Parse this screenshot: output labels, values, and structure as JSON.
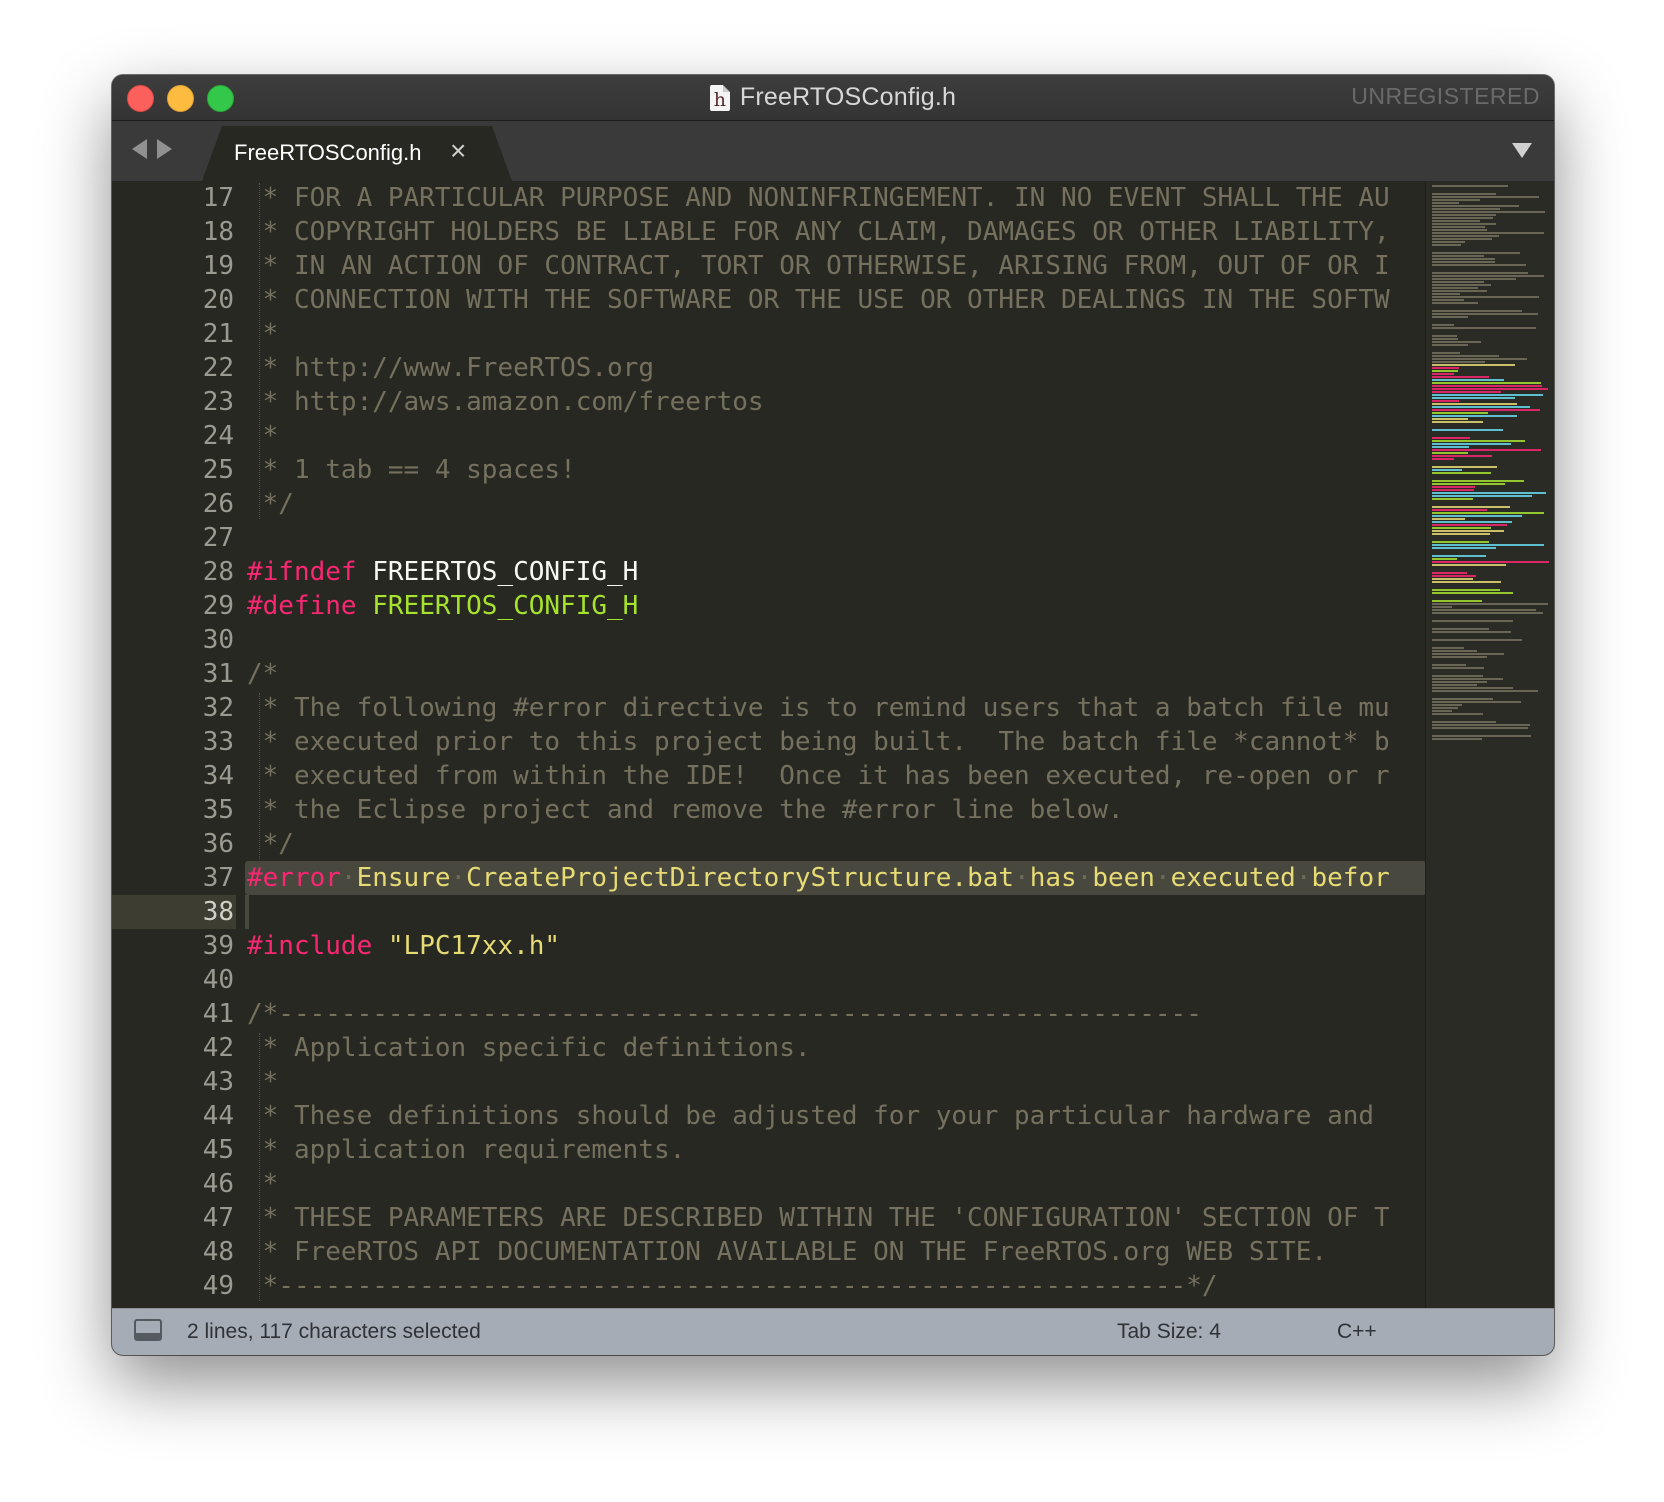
{
  "window": {
    "title": "FreeRTOSConfig.h",
    "file_icon_glyph": "h",
    "registration": "UNREGISTERED"
  },
  "tabs": [
    {
      "label": "FreeRTOSConfig.h",
      "close_glyph": "×",
      "active": true
    }
  ],
  "editor": {
    "current_line": 38,
    "selected_lines": [
      37,
      38
    ],
    "lines": [
      {
        "n": "17",
        "tokens": [
          {
            "t": " * FOR A PARTICULAR PURPOSE AND NONINFRINGEMENT. IN NO EVENT SHALL THE AU",
            "k": "comment"
          }
        ]
      },
      {
        "n": "18",
        "tokens": [
          {
            "t": " * COPYRIGHT HOLDERS BE LIABLE FOR ANY CLAIM, DAMAGES OR OTHER LIABILITY, ",
            "k": "comment"
          }
        ]
      },
      {
        "n": "19",
        "tokens": [
          {
            "t": " * IN AN ACTION OF CONTRACT, TORT OR OTHERWISE, ARISING FROM, OUT OF OR I",
            "k": "comment"
          }
        ]
      },
      {
        "n": "20",
        "tokens": [
          {
            "t": " * CONNECTION WITH THE SOFTWARE OR THE USE OR OTHER DEALINGS IN THE SOFTW",
            "k": "comment"
          }
        ]
      },
      {
        "n": "21",
        "tokens": [
          {
            "t": " *",
            "k": "comment"
          }
        ]
      },
      {
        "n": "22",
        "tokens": [
          {
            "t": " * http://www.FreeRTOS.org",
            "k": "comment"
          }
        ]
      },
      {
        "n": "23",
        "tokens": [
          {
            "t": " * http://aws.amazon.com/freertos",
            "k": "comment"
          }
        ]
      },
      {
        "n": "24",
        "tokens": [
          {
            "t": " *",
            "k": "comment"
          }
        ]
      },
      {
        "n": "25",
        "tokens": [
          {
            "t": " * 1 tab == 4 spaces!",
            "k": "comment"
          }
        ]
      },
      {
        "n": "26",
        "tokens": [
          {
            "t": " */",
            "k": "comment"
          }
        ]
      },
      {
        "n": "27",
        "tokens": []
      },
      {
        "n": "28",
        "tokens": [
          {
            "t": "#ifndef",
            "k": "kw"
          },
          {
            "t": " FREERTOS_CONFIG_H",
            "k": "id"
          }
        ]
      },
      {
        "n": "29",
        "tokens": [
          {
            "t": "#define",
            "k": "kw"
          },
          {
            "t": " FREERTOS_CONFIG_H",
            "k": "def"
          }
        ]
      },
      {
        "n": "30",
        "tokens": []
      },
      {
        "n": "31",
        "tokens": [
          {
            "t": "/*",
            "k": "comment"
          }
        ]
      },
      {
        "n": "32",
        "tokens": [
          {
            "t": " * The following #error directive is to remind users that a batch file mu",
            "k": "comment"
          }
        ]
      },
      {
        "n": "33",
        "tokens": [
          {
            "t": " * executed prior to this project being built.  The batch file *cannot* b",
            "k": "comment"
          }
        ]
      },
      {
        "n": "34",
        "tokens": [
          {
            "t": " * executed from within the IDE!  Once it has been executed, re-open or r",
            "k": "comment"
          }
        ]
      },
      {
        "n": "35",
        "tokens": [
          {
            "t": " * the Eclipse project and remove the #error line below.",
            "k": "comment"
          }
        ]
      },
      {
        "n": "36",
        "tokens": [
          {
            "t": " */",
            "k": "comment"
          }
        ]
      },
      {
        "n": "37",
        "tokens": [
          {
            "t": "#error",
            "k": "kw"
          },
          {
            "t": "·",
            "k": "ws"
          },
          {
            "t": "Ensure",
            "k": "str"
          },
          {
            "t": "·",
            "k": "ws"
          },
          {
            "t": "CreateProjectDirectoryStructure.bat",
            "k": "str"
          },
          {
            "t": "·",
            "k": "ws"
          },
          {
            "t": "has",
            "k": "str"
          },
          {
            "t": "·",
            "k": "ws"
          },
          {
            "t": "been",
            "k": "str"
          },
          {
            "t": "·",
            "k": "ws"
          },
          {
            "t": "executed",
            "k": "str"
          },
          {
            "t": "·",
            "k": "ws"
          },
          {
            "t": "befor",
            "k": "str"
          }
        ]
      },
      {
        "n": "38",
        "tokens": []
      },
      {
        "n": "39",
        "tokens": [
          {
            "t": "#include",
            "k": "kw"
          },
          {
            "t": " \"LPC17xx.h\"",
            "k": "str"
          }
        ]
      },
      {
        "n": "40",
        "tokens": []
      },
      {
        "n": "41",
        "tokens": [
          {
            "t": "/*-----------------------------------------------------------",
            "k": "comment"
          }
        ]
      },
      {
        "n": "42",
        "tokens": [
          {
            "t": " * Application specific definitions.",
            "k": "comment"
          }
        ]
      },
      {
        "n": "43",
        "tokens": [
          {
            "t": " *",
            "k": "comment"
          }
        ]
      },
      {
        "n": "44",
        "tokens": [
          {
            "t": " * These definitions should be adjusted for your particular hardware and",
            "k": "comment"
          }
        ]
      },
      {
        "n": "45",
        "tokens": [
          {
            "t": " * application requirements.",
            "k": "comment"
          }
        ]
      },
      {
        "n": "46",
        "tokens": [
          {
            "t": " *",
            "k": "comment"
          }
        ]
      },
      {
        "n": "47",
        "tokens": [
          {
            "t": " * THESE PARAMETERS ARE DESCRIBED WITHIN THE 'CONFIGURATION' SECTION OF T",
            "k": "comment"
          }
        ]
      },
      {
        "n": "48",
        "tokens": [
          {
            "t": " * FreeRTOS API DOCUMENTATION AVAILABLE ON THE FreeRTOS.org WEB SITE.",
            "k": "comment"
          }
        ]
      },
      {
        "n": "49",
        "tokens": [
          {
            "t": " *----------------------------------------------------------*/",
            "k": "comment"
          }
        ]
      }
    ]
  },
  "status": {
    "selection": "2 lines, 117 characters selected",
    "tab_size": "Tab Size: 4",
    "syntax": "C++"
  },
  "colors": {
    "background": "#272822",
    "comment": "#75715e",
    "keyword": "#f92672",
    "string": "#e6db74",
    "define": "#a6e22e",
    "text": "#f8f8f2",
    "statusbar": "#a6acb6"
  },
  "icons": {
    "back": "triangle-left-icon",
    "forward": "triangle-right-icon",
    "tab_menu": "chevron-down-icon",
    "panel_toggle": "panel-icon"
  }
}
